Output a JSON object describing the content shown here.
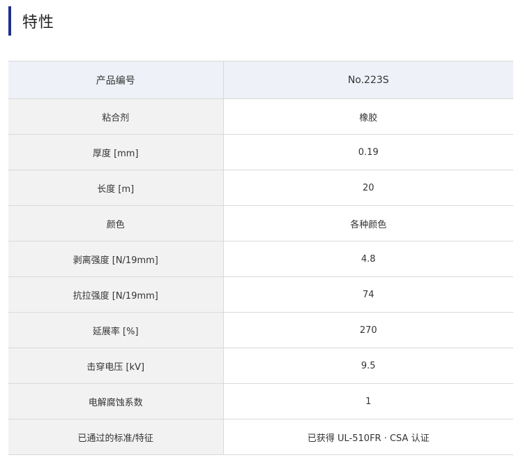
{
  "heading": {
    "title": "特性",
    "accent_color": "#1f2f8a"
  },
  "table": {
    "header": {
      "label": "产品编号",
      "value": "No.223S"
    },
    "rows": [
      {
        "label": "粘合剂",
        "value": "橡胶"
      },
      {
        "label": "厚度 [mm]",
        "value": "0.19"
      },
      {
        "label": "长度 [m]",
        "value": "20"
      },
      {
        "label": "颜色",
        "value": "各种颜色"
      },
      {
        "label": "剥离强度 [N/19mm]",
        "value": "4.8"
      },
      {
        "label": "抗拉强度 [N/19mm]",
        "value": "74"
      },
      {
        "label": "延展率 [%]",
        "value": "270"
      },
      {
        "label": "击穿电压 [kV]",
        "value": "9.5"
      },
      {
        "label": "电解腐蚀系数",
        "value": "1"
      },
      {
        "label": "已通过的标准/特征",
        "value": "已获得 UL-510FR · CSA 认证"
      }
    ]
  }
}
